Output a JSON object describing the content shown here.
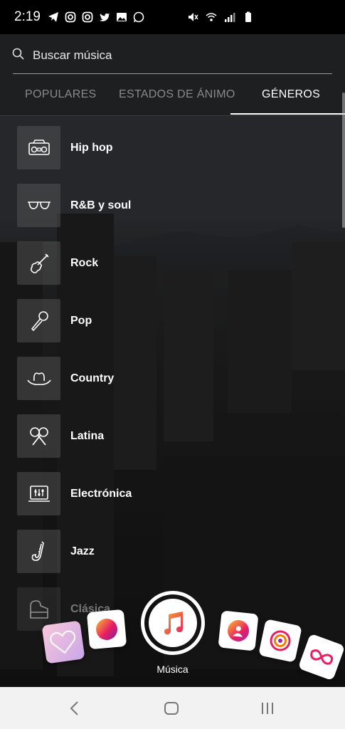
{
  "status_bar": {
    "time": "2:19",
    "left_icons": [
      "telegram-icon",
      "instagram-icon",
      "instagram-icon",
      "twitter-icon",
      "gallery-icon",
      "whatsapp-icon"
    ],
    "right_icons": [
      "mute-icon",
      "wifi-icon",
      "signal-icon",
      "battery-icon"
    ]
  },
  "search": {
    "placeholder": "Buscar música"
  },
  "tabs": [
    {
      "label": "POPULARES",
      "active": false
    },
    {
      "label": "ESTADOS DE ÁNIMO",
      "active": false
    },
    {
      "label": "GÉNEROS",
      "active": true
    }
  ],
  "genres": [
    {
      "label": "Hip hop",
      "icon": "boombox-icon"
    },
    {
      "label": "R&B y soul",
      "icon": "sunglasses-icon"
    },
    {
      "label": "Rock",
      "icon": "guitar-icon"
    },
    {
      "label": "Pop",
      "icon": "microphone-icon"
    },
    {
      "label": "Country",
      "icon": "cowboy-hat-icon"
    },
    {
      "label": "Latina",
      "icon": "maracas-icon"
    },
    {
      "label": "Electrónica",
      "icon": "mixer-icon"
    },
    {
      "label": "Jazz",
      "icon": "saxophone-icon"
    },
    {
      "label": "Clásica",
      "icon": "piano-icon"
    }
  ],
  "carousel": {
    "selected_label": "Música",
    "effects": [
      "heart-effect-icon",
      "gradient-circle-icon",
      "music-note-icon",
      "profile-icon",
      "rings-icon",
      "infinity-icon"
    ]
  },
  "nav_bar": {
    "buttons": [
      "back-icon",
      "home-icon",
      "recents-icon"
    ]
  },
  "colors": {
    "accent_gradient_start": "#f9a825",
    "accent_gradient_end": "#e91e63",
    "active_tab": "#ffffff",
    "inactive_tab": "#8a8a8a"
  }
}
